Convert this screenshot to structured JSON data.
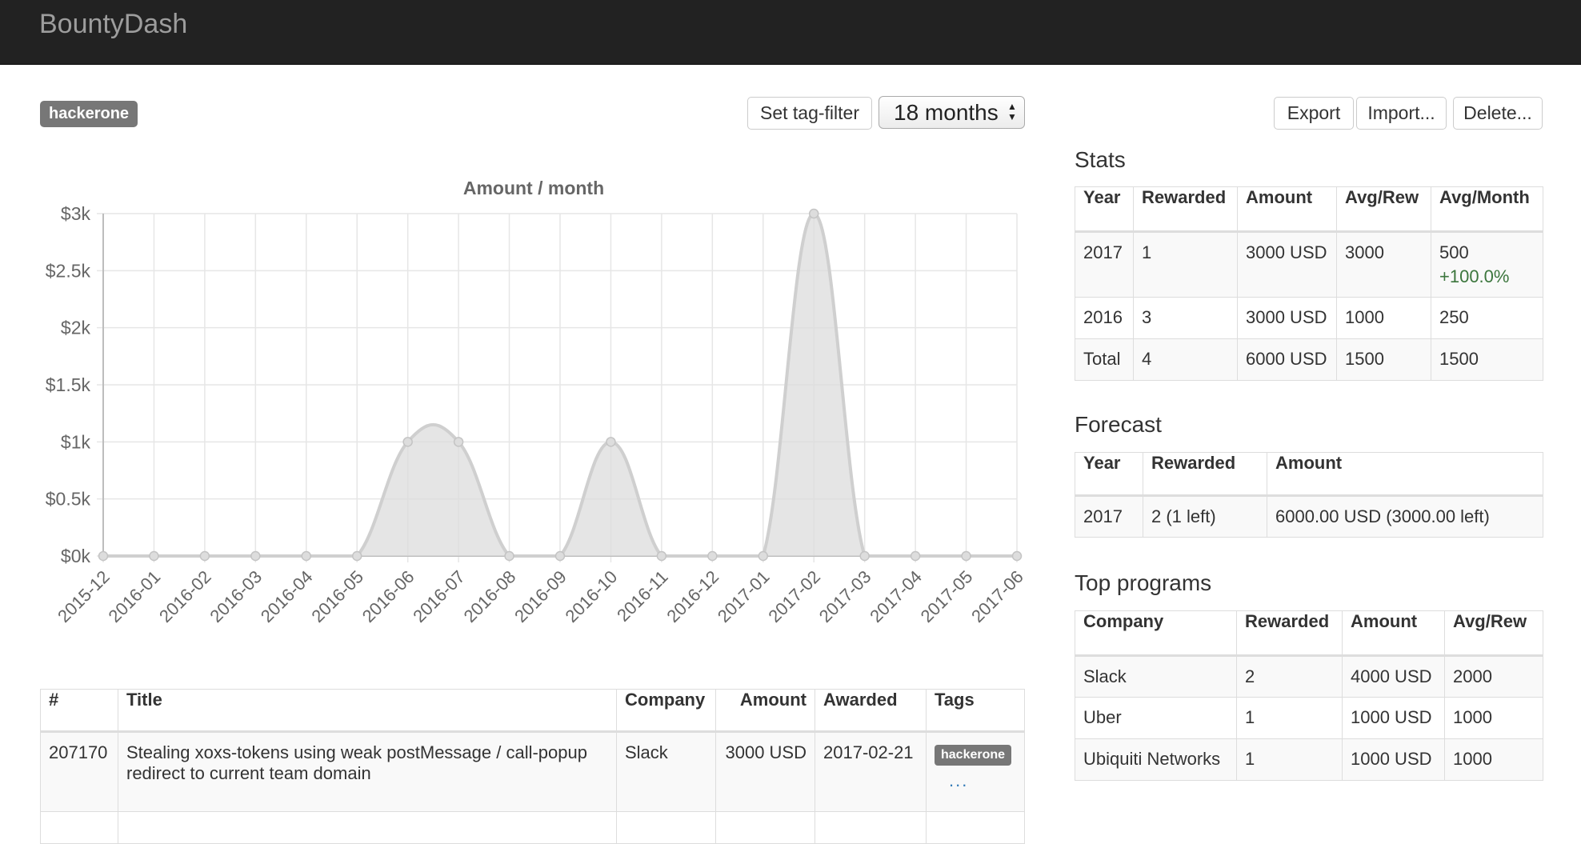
{
  "app": {
    "brand": "BountyDash"
  },
  "toolbar": {
    "active_tag": "hackerone",
    "set_tag_filter": "Set tag-filter",
    "period": "18 months",
    "export": "Export",
    "import": "Import...",
    "delete": "Delete..."
  },
  "chart_data": {
    "type": "area",
    "title": "Amount / month",
    "xlabel": "",
    "ylabel": "",
    "categories": [
      "2015-12",
      "2016-01",
      "2016-02",
      "2016-03",
      "2016-04",
      "2016-05",
      "2016-06",
      "2016-07",
      "2016-08",
      "2016-09",
      "2016-10",
      "2016-11",
      "2016-12",
      "2017-01",
      "2017-02",
      "2017-03",
      "2017-04",
      "2017-05",
      "2017-06"
    ],
    "values": [
      0,
      0,
      0,
      0,
      0,
      0,
      1000,
      1000,
      0,
      0,
      1000,
      0,
      0,
      0,
      3000,
      0,
      0,
      0,
      0
    ],
    "ylim": [
      0,
      3000
    ],
    "yticks": [
      "$0k",
      "$0.5k",
      "$1k",
      "$1.5k",
      "$2k",
      "$2.5k",
      "$3k"
    ],
    "grid": true,
    "fill_color": "#dcdcdc",
    "line_color": "#cfcfcf"
  },
  "stats": {
    "title": "Stats",
    "headers": [
      "Year",
      "Rewarded",
      "Amount",
      "Avg/Rew",
      "Avg/Month"
    ],
    "rows": [
      {
        "year": "2017",
        "rewarded": "1",
        "amount": "3000 USD",
        "avg_rew": "3000",
        "avg_month": "500",
        "change": "+100.0%"
      },
      {
        "year": "2016",
        "rewarded": "3",
        "amount": "3000 USD",
        "avg_rew": "1000",
        "avg_month": "250",
        "change": ""
      },
      {
        "year": "Total",
        "rewarded": "4",
        "amount": "6000 USD",
        "avg_rew": "1500",
        "avg_month": "1500",
        "change": ""
      }
    ]
  },
  "forecast": {
    "title": "Forecast",
    "headers": [
      "Year",
      "Rewarded",
      "Amount"
    ],
    "rows": [
      {
        "year": "2017",
        "rewarded": "2 (1 left)",
        "amount": "6000.00 USD (3000.00 left)"
      }
    ]
  },
  "top_programs": {
    "title": "Top programs",
    "headers": [
      "Company",
      "Rewarded",
      "Amount",
      "Avg/Rew"
    ],
    "rows": [
      {
        "company": "Slack",
        "rewarded": "2",
        "amount": "4000 USD",
        "avg_rew": "2000"
      },
      {
        "company": "Uber",
        "rewarded": "1",
        "amount": "1000 USD",
        "avg_rew": "1000"
      },
      {
        "company": "Ubiquiti Networks",
        "rewarded": "1",
        "amount": "1000 USD",
        "avg_rew": "1000"
      }
    ]
  },
  "reports": {
    "headers": [
      "#",
      "Title",
      "Company",
      "Amount",
      "Awarded",
      "Tags"
    ],
    "rows": [
      {
        "id": "207170",
        "title": "Stealing xoxs-tokens using weak postMessage / call-popup redirect to current team domain",
        "company": "Slack",
        "amount": "3000 USD",
        "awarded": "2017-02-21",
        "tag": "hackerone",
        "more": "..."
      }
    ]
  }
}
